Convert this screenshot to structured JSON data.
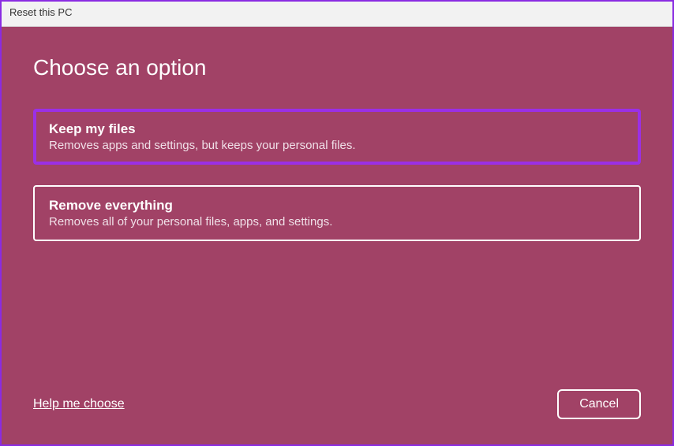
{
  "window": {
    "title": "Reset this PC"
  },
  "heading": "Choose an option",
  "options": [
    {
      "title": "Keep my files",
      "description": "Removes apps and settings, but keeps your personal files."
    },
    {
      "title": "Remove everything",
      "description": "Removes all of your personal files, apps, and settings."
    }
  ],
  "footer": {
    "help_link": "Help me choose",
    "cancel_label": "Cancel"
  }
}
